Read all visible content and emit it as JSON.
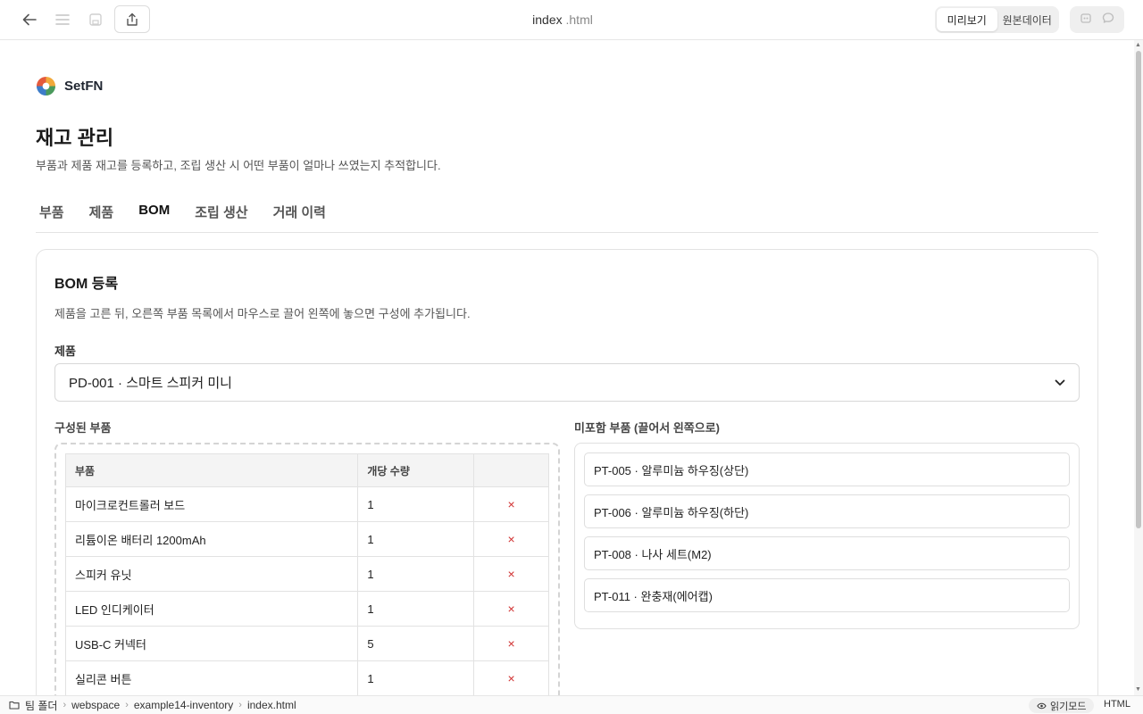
{
  "app": {
    "filename": "index",
    "extension": ".html",
    "view_toggle": {
      "preview": "미리보기",
      "source": "원본데이터"
    }
  },
  "brand": {
    "name": "SetFN"
  },
  "page": {
    "title": "재고 관리",
    "subtitle": "부품과 제품 재고를 등록하고, 조립 생산 시 어떤 부품이 얼마나 쓰였는지 추적합니다."
  },
  "tabs": [
    {
      "label": "부품",
      "active": false
    },
    {
      "label": "제품",
      "active": false
    },
    {
      "label": "BOM",
      "active": true
    },
    {
      "label": "조립 생산",
      "active": false
    },
    {
      "label": "거래 이력",
      "active": false
    }
  ],
  "bom": {
    "title": "BOM 등록",
    "description": "제품을 고른 뒤, 오른쪽 부품 목록에서 마우스로 끌어 왼쪽에 놓으면 구성에 추가됩니다.",
    "product_label": "제품",
    "product_selected": "PD-001 · 스마트 스피커 미니",
    "configured_label": "구성된 부품",
    "available_label": "미포함 부품 (끌어서 왼쪽으로)",
    "table_headers": {
      "part": "부품",
      "qty": "개당 수량",
      "action": ""
    },
    "configured": [
      {
        "part": "마이크로컨트롤러 보드",
        "qty": "1",
        "remove": "×"
      },
      {
        "part": "리튬이온 배터리 1200mAh",
        "qty": "1",
        "remove": "×"
      },
      {
        "part": "스피커 유닛",
        "qty": "1",
        "remove": "×"
      },
      {
        "part": "LED 인디케이터",
        "qty": "1",
        "remove": "×"
      },
      {
        "part": "USB-C 커넥터",
        "qty": "5",
        "remove": "×"
      },
      {
        "part": "실리콘 버튼",
        "qty": "1",
        "remove": "×"
      }
    ],
    "available": [
      "PT-005 · 알루미늄 하우징(상단)",
      "PT-006 · 알루미늄 하우징(하단)",
      "PT-008 · 나사 세트(M2)",
      "PT-011 · 완충재(에어캡)"
    ]
  },
  "statusbar": {
    "breadcrumb": [
      "팀 폴더",
      "webspace",
      "example14-inventory",
      "index.html"
    ],
    "read_mode": "읽기모드",
    "file_type": "HTML"
  }
}
